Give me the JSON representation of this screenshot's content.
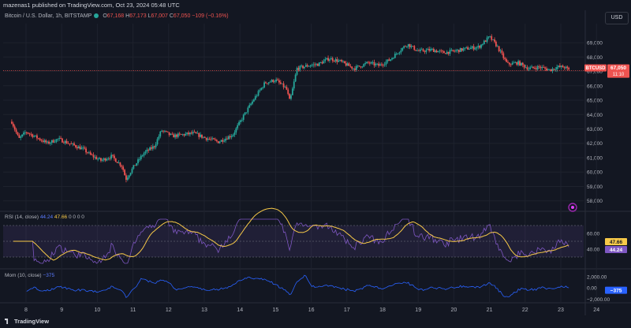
{
  "header": {
    "publisher_line": "mazenas1 published on TradingView.com, Oct 23, 2024 05:48 UTC",
    "symbol_title": "Bitcoin / U.S. Dollar, 1h, BITSTAMP",
    "ohlc": {
      "o_label": "O",
      "o": "67,168",
      "h_label": "H",
      "h": "67,173",
      "l_label": "L",
      "l": "67,007",
      "c_label": "C",
      "c": "67,050",
      "change": "−109 (−0.16%)"
    },
    "currency_button": "USD"
  },
  "price_badge": {
    "ticker": "BTCUSD",
    "price": "67,050",
    "countdown": "11:10"
  },
  "rsi": {
    "label": "RSI (14, close)",
    "v1": "44.24",
    "v2": "47.66",
    "zeros": "0 0 0 0",
    "axis": [
      "60.00",
      "40.00"
    ],
    "badge_main": "47.66",
    "badge_sub": "44.24"
  },
  "mom": {
    "label": "Mom (10, close)",
    "value": "−375",
    "axis": [
      "2,000.00",
      "0.00",
      "−2,000.00"
    ],
    "badge": "−375"
  },
  "footer": {
    "brand": "TradingView"
  },
  "colors": {
    "bg": "#131722",
    "up": "#26a69a",
    "down": "#ef5350",
    "rsi": "#7e57c2",
    "rsi_ma": "#f7c948",
    "mom": "#2962ff",
    "grid": "#1e222d"
  },
  "chart_data": [
    {
      "type": "candlestick",
      "title": "Bitcoin / U.S. Dollar, 1h, BITSTAMP",
      "x_ticks": [
        "8",
        "9",
        "10",
        "11",
        "12",
        "13",
        "14",
        "15",
        "16",
        "17",
        "18",
        "19",
        "20",
        "21",
        "22",
        "23",
        "24"
      ],
      "y_ticks": [
        "69,000",
        "68,000",
        "67,000",
        "66,000",
        "65,000",
        "64,000",
        "63,000",
        "62,000",
        "61,000",
        "60,000",
        "59,000",
        "58,000"
      ],
      "ylim": [
        57600,
        70100
      ],
      "close_path_by_day": [
        [
          7.6,
          63500
        ],
        [
          7.8,
          62300
        ],
        [
          8.0,
          62800
        ],
        [
          8.3,
          62400
        ],
        [
          8.6,
          62000
        ],
        [
          8.9,
          62300
        ],
        [
          9.2,
          62000
        ],
        [
          9.6,
          61600
        ],
        [
          9.8,
          61200
        ],
        [
          10.1,
          60800
        ],
        [
          10.4,
          61100
        ],
        [
          10.7,
          60400
        ],
        [
          10.8,
          59500
        ],
        [
          11.0,
          60300
        ],
        [
          11.3,
          61300
        ],
        [
          11.6,
          61800
        ],
        [
          11.8,
          62900
        ],
        [
          12.1,
          62500
        ],
        [
          12.4,
          62600
        ],
        [
          12.7,
          62700
        ],
        [
          13.0,
          62400
        ],
        [
          13.4,
          62100
        ],
        [
          13.8,
          62600
        ],
        [
          14.1,
          63900
        ],
        [
          14.4,
          65100
        ],
        [
          14.7,
          66200
        ],
        [
          15.0,
          66400
        ],
        [
          15.3,
          65800
        ],
        [
          15.4,
          64900
        ],
        [
          15.6,
          67200
        ],
        [
          15.9,
          67400
        ],
        [
          16.2,
          67500
        ],
        [
          16.5,
          67900
        ],
        [
          16.8,
          67700
        ],
        [
          17.2,
          67200
        ],
        [
          17.6,
          67600
        ],
        [
          17.9,
          67400
        ],
        [
          18.2,
          67800
        ],
        [
          18.5,
          68500
        ],
        [
          18.7,
          68900
        ],
        [
          19.0,
          68400
        ],
        [
          19.4,
          68500
        ],
        [
          19.7,
          68300
        ],
        [
          20.0,
          68400
        ],
        [
          20.4,
          68600
        ],
        [
          20.7,
          68700
        ],
        [
          21.0,
          69400
        ],
        [
          21.2,
          68800
        ],
        [
          21.5,
          67500
        ],
        [
          21.8,
          67600
        ],
        [
          22.1,
          67200
        ],
        [
          22.4,
          67300
        ],
        [
          22.7,
          67100
        ],
        [
          22.9,
          67300
        ],
        [
          23.1,
          67300
        ],
        [
          23.25,
          67050
        ]
      ]
    },
    {
      "type": "line",
      "title": "RSI (14, close)",
      "series": [
        {
          "name": "RSI",
          "last": 44.24
        },
        {
          "name": "MA",
          "last": 47.66
        }
      ],
      "bands": [
        30,
        50,
        70
      ],
      "y_ticks": [
        "60.00",
        "40.00"
      ]
    },
    {
      "type": "line",
      "title": "Mom (10, close)",
      "series": [
        {
          "name": "Mom",
          "last": -375
        }
      ],
      "y_ticks": [
        "2,000.00",
        "0.00",
        "−2,000.00"
      ]
    }
  ]
}
